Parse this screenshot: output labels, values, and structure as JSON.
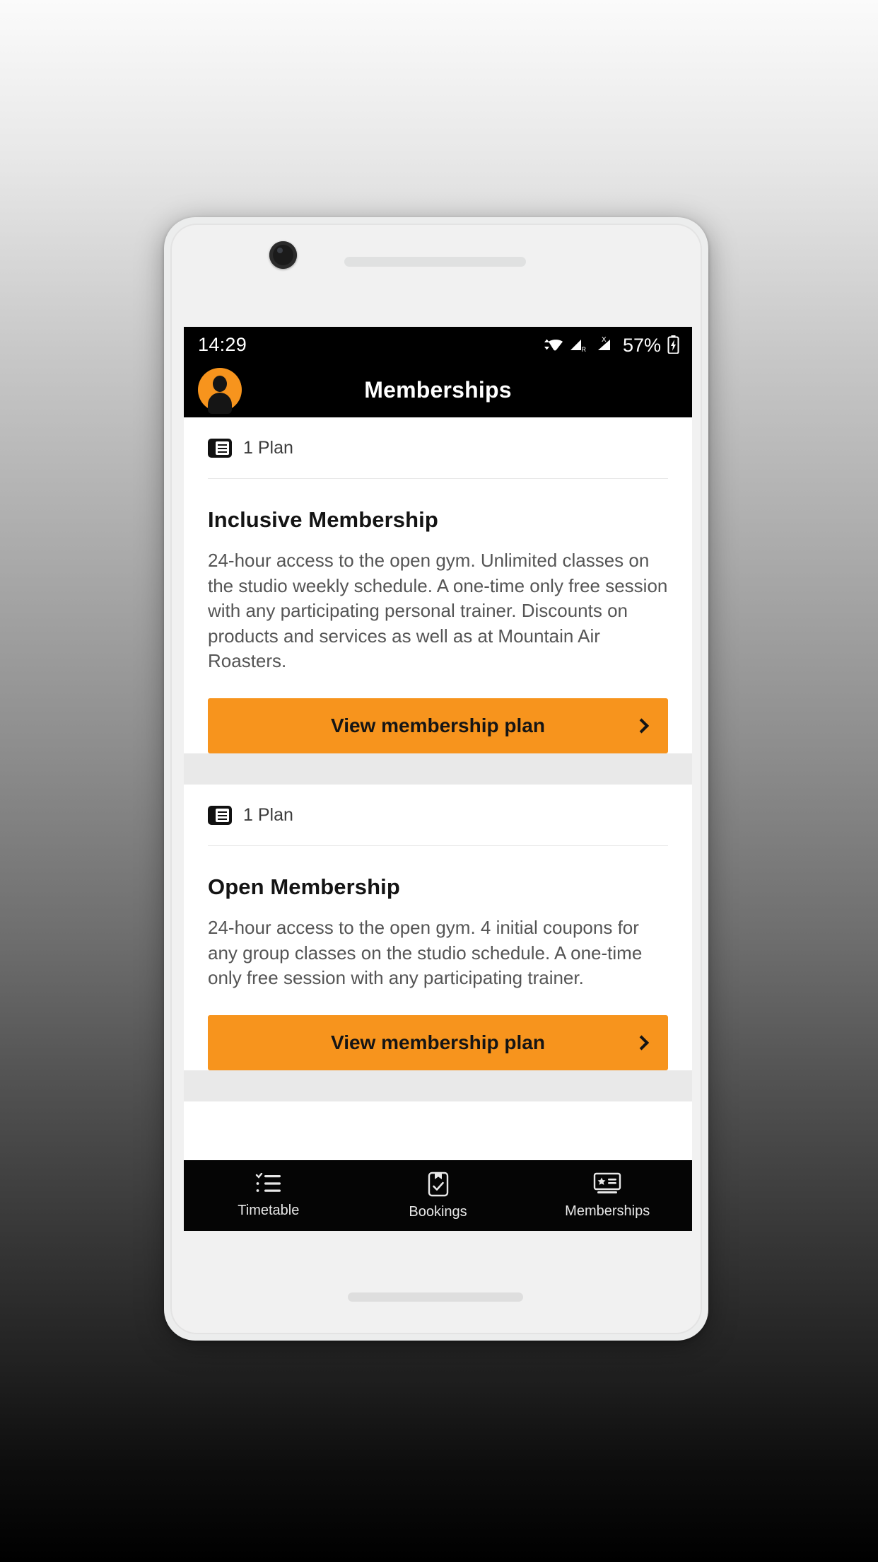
{
  "status_bar": {
    "time": "14:29",
    "battery_percent": "57%",
    "icons": [
      "wifi-icon",
      "signal-roaming-icon",
      "signal-no-sim-icon",
      "battery-charging-icon"
    ],
    "signal_roaming_label": "R",
    "signal_x_label": "X"
  },
  "app_bar": {
    "title": "Memberships",
    "avatar_icon": "user-avatar-icon"
  },
  "colors": {
    "accent": "#f7941d",
    "app_bar_bg": "#000000",
    "card_bg": "#ffffff",
    "page_bg": "#e9e9e9",
    "body_text": "#555555",
    "title_text": "#141414"
  },
  "memberships": [
    {
      "plan_count": "1 Plan",
      "plan_icon": "membership-card-icon",
      "title": "Inclusive Membership",
      "description": "24-hour access to the open gym. Unlimited classes on the studio weekly schedule. A one-time only free session with any participating personal trainer. Discounts on products and services as well as at Mountain Air Roasters.",
      "button_label": "View membership plan"
    },
    {
      "plan_count": "1 Plan",
      "plan_icon": "membership-card-icon",
      "title": "Open Membership",
      "description": "24-hour access to the open gym. 4 initial coupons for any group classes on the studio schedule. A one-time only free session with any participating trainer.",
      "button_label": "View membership plan"
    }
  ],
  "bottom_nav": {
    "items": [
      {
        "label": "Timetable",
        "icon": "list-icon",
        "active": false
      },
      {
        "label": "Bookings",
        "icon": "clipboard-check-icon",
        "active": false
      },
      {
        "label": "Memberships",
        "icon": "membership-star-icon",
        "active": true
      }
    ]
  }
}
